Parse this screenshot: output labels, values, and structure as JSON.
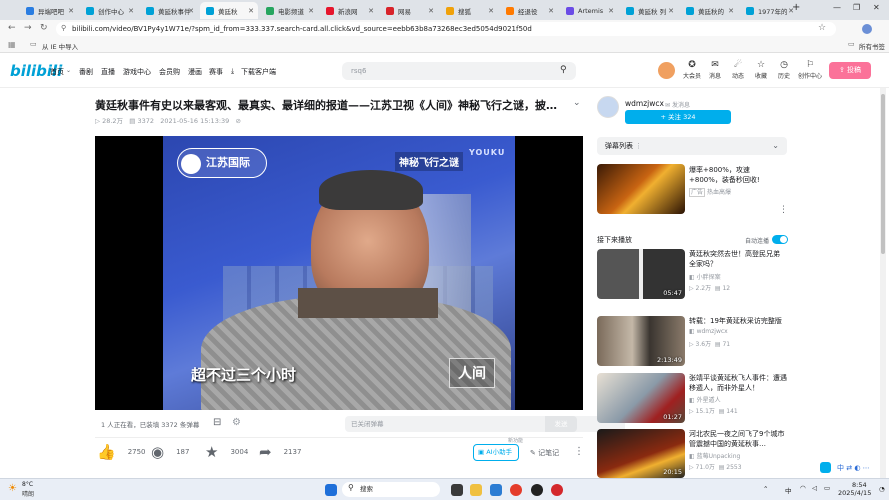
{
  "tabs": [
    {
      "label": "异端吧吧",
      "color": "#2a7de1"
    },
    {
      "label": "创作中心",
      "color": "#00a1d6"
    },
    {
      "label": "黄延秋事件",
      "color": "#00a1d6"
    },
    {
      "label": "黄廷秋",
      "color": "#00a1d6",
      "active": true
    },
    {
      "label": "电影频道",
      "color": "#25a55f"
    },
    {
      "label": "新浪网",
      "color": "#e6162d"
    },
    {
      "label": "网易",
      "color": "#d8232a"
    },
    {
      "label": "搜狐",
      "color": "#f0a10a"
    },
    {
      "label": "经退役",
      "color": "#ff7a00"
    },
    {
      "label": "Artemis",
      "color": "#6b4ce6"
    },
    {
      "label": "黄延秋 列",
      "color": "#00a1d6"
    },
    {
      "label": "黄廷秋的",
      "color": "#00a1d6"
    },
    {
      "label": "1977年的",
      "color": "#00a1d6"
    }
  ],
  "browser": {
    "url": "bilibili.com/video/BV1Py4y1W71e/?spm_id_from=333.337.search-card.all.click&vd_source=eebb63b8a73268ec3ed5054d9021f50d",
    "bookmark_import": "从 IE 中导入",
    "all_bookmarks": "所有书签"
  },
  "header": {
    "logo": "bilibili",
    "nav": [
      "首页",
      "番剧",
      "直播",
      "游戏中心",
      "会员购",
      "漫画",
      "赛事",
      "下载客户端"
    ],
    "search_placeholder": "rsq6",
    "icons": [
      {
        "label": "大会员",
        "glyph": "✪"
      },
      {
        "label": "消息",
        "glyph": "✉"
      },
      {
        "label": "动态",
        "glyph": "☄"
      },
      {
        "label": "收藏",
        "glyph": "☆"
      },
      {
        "label": "历史",
        "glyph": "◷"
      },
      {
        "label": "创作中心",
        "glyph": "⚐"
      }
    ],
    "upload": "投稿"
  },
  "video": {
    "title": "黄廷秋事件有史以来最客观、最真实、最详细的报道——江苏卫视《人间》神秘飞行之谜，披露了很多…",
    "views": "28.2万",
    "danmaku": "3372",
    "date": "2021-05-16 15:13:39",
    "overlay_channel": "江苏国际",
    "overlay_program": "神秘飞行之谜",
    "overlay_watermark": "YOUKU",
    "subtitle": "超不过三个小时",
    "overlay_corner": "人间"
  },
  "danmu_bar": {
    "watching": "1 人正在看，已装填 3372 条弹幕",
    "placeholder": "已关闭弹幕",
    "send": "发送"
  },
  "actions": {
    "like": "2750",
    "coin": "187",
    "fav": "3004",
    "share": "2137",
    "ai": "AI小助手",
    "ai_tag": "新功能",
    "notes": "记笔记"
  },
  "uploader": {
    "name": "wdmzjwcx",
    "message": "发消息",
    "follow": "+ 关注 324"
  },
  "danmaku_list": "弹幕列表",
  "ad": {
    "title": "爆率+800%，攻速+800%，装备秒回收!",
    "tag": "广告",
    "source": "热血高爆"
  },
  "next_play": {
    "label": "接下来播放",
    "autoplay": "自动连播"
  },
  "recommend": [
    {
      "title": "黄廷秋突然去世！高登民兄弟全家吗？",
      "up": "小胖探案",
      "views": "2.2万",
      "comments": "12",
      "duration": "05:47"
    },
    {
      "title": "转载：19年黄延秋采访完整版",
      "up": "wdmzjwcx",
      "views": "3.6万",
      "comments": "71",
      "duration": "2:13:49"
    },
    {
      "title": "张靖平谈黄延秋飞人事件：遭遇移遁人，而非外星人！",
      "up": "外星遁人",
      "views": "15.1万",
      "comments": "141",
      "duration": "01:27"
    },
    {
      "title": "河北农民一夜之间飞了9个城市 管震撼中国的黄延秋事…",
      "up": "蓝莓Unpacking",
      "views": "71.0万",
      "comments": "2553",
      "duration": "20:15"
    }
  ],
  "taskbar": {
    "weather_temp": "8°C",
    "weather_desc": "晴朗",
    "search": "搜索",
    "time": "8:54",
    "date": "2025/4/15",
    "ime": "中"
  }
}
